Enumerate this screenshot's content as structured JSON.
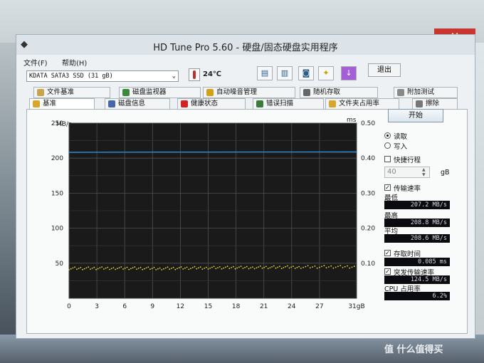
{
  "window": {
    "title": "HD Tune Pro 5.60 - 硬盘/固态硬盘实用程序",
    "close_glyph": "✕"
  },
  "menu": {
    "file": "文件(F)",
    "help": "帮助(H)"
  },
  "toolbar": {
    "drive": "KDATA SATA3  SSD (31 gB)",
    "temperature": "24℃",
    "exit_label": "退出",
    "buttons": [
      "copy-info-icon",
      "copy-info-icon",
      "camera-icon",
      "wrench-icon",
      "download-icon"
    ]
  },
  "tabs_row1": [
    {
      "label": "文件基准",
      "icon": "file-benchmark-icon"
    },
    {
      "label": "磁盘监视器",
      "icon": "disk-monitor-icon"
    },
    {
      "label": "自动噪音管理",
      "icon": "speaker-icon"
    },
    {
      "label": "随机存取",
      "icon": "random-access-icon"
    },
    {
      "label": "附加测试",
      "icon": "extra-tests-icon"
    }
  ],
  "tabs_row2": [
    {
      "label": "基准",
      "icon": "benchmark-icon"
    },
    {
      "label": "磁盘信息",
      "icon": "disk-info-icon"
    },
    {
      "label": "健康状态",
      "icon": "health-icon"
    },
    {
      "label": "错误扫描",
      "icon": "error-scan-icon"
    },
    {
      "label": "文件夹占用率",
      "icon": "folder-usage-icon"
    },
    {
      "label": "擦除",
      "icon": "erase-icon"
    }
  ],
  "panel": {
    "start_label": "开始",
    "read_label": "读取",
    "write_label": "写入",
    "quick_label": "快捷行程",
    "quick_value": "40",
    "quick_unit": "gB",
    "transfer_label": "传输速率",
    "min_label": "最低",
    "min_value": "207.2 MB/s",
    "max_label": "最高",
    "max_value": "208.8 MB/s",
    "avg_label": "平均",
    "avg_value": "208.6 MB/s",
    "access_label": "存取时间",
    "access_value": "0.085 ms",
    "burst_label": "突发传输速率",
    "burst_value": "124.5 MB/s",
    "cpu_label": "CPU 占用率",
    "cpu_value": "6.2%"
  },
  "chart_data": {
    "type": "line",
    "yunit_left": "MB/s",
    "yunit_right": "ms",
    "xunit": "gB",
    "ylim": [
      0,
      250
    ],
    "ylim_right": [
      0,
      0.5
    ],
    "xlim": [
      0,
      31
    ],
    "yticks": [
      50,
      100,
      150,
      200,
      250
    ],
    "yticks_right": [
      "0.10",
      "0.20",
      "0.30",
      "0.40",
      "0.50"
    ],
    "xticks": [
      "0",
      "3",
      "6",
      "9",
      "12",
      "15",
      "18",
      "21",
      "24",
      "27",
      "31gB"
    ],
    "grid": true,
    "series": [
      {
        "color": "#2f8fd8",
        "x": [
          0,
          5,
          10,
          15,
          20,
          25,
          31
        ],
        "y": [
          208.3,
          208.5,
          208.6,
          208.6,
          208.7,
          208.7,
          208.8
        ]
      },
      {
        "color": "#e8e03a",
        "x": [
          0,
          5,
          10,
          15,
          20,
          25,
          31
        ],
        "y": [
          0.085,
          0.086,
          0.085,
          0.087,
          0.088,
          0.089,
          0.09
        ]
      }
    ]
  },
  "watermark": "值 什么值得买"
}
